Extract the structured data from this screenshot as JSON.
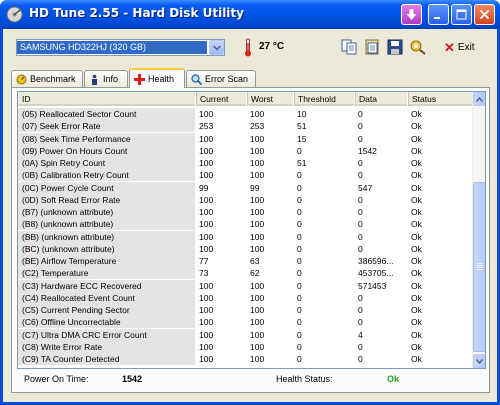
{
  "window": {
    "title": "HD Tune 2.55 - Hard Disk Utility"
  },
  "toolbar": {
    "drive": "SAMSUNG HD322HJ (320 GB)",
    "temperature": "27 °C",
    "exit_label": "Exit"
  },
  "tabs": [
    {
      "label": "Benchmark",
      "icon": "benchmark-icon"
    },
    {
      "label": "Info",
      "icon": "info-icon"
    },
    {
      "label": "Health",
      "icon": "health-cross-icon",
      "active": true
    },
    {
      "label": "Error Scan",
      "icon": "magnifier-icon"
    }
  ],
  "table": {
    "columns": [
      "ID",
      "Current",
      "Worst",
      "Threshold",
      "Data",
      "Status"
    ],
    "rows": [
      [
        "(05) Reallocated Sector Count",
        "100",
        "100",
        "10",
        "0",
        "Ok"
      ],
      [
        "(07) Seek Error Rate",
        "253",
        "253",
        "51",
        "0",
        "Ok"
      ],
      [
        "(08) Seek Time Performance",
        "100",
        "100",
        "15",
        "0",
        "Ok"
      ],
      [
        "(09) Power On Hours Count",
        "100",
        "100",
        "0",
        "1542",
        "Ok"
      ],
      [
        "(0A) Spin Retry Count",
        "100",
        "100",
        "51",
        "0",
        "Ok"
      ],
      [
        "(0B) Calibration Retry Count",
        "100",
        "100",
        "0",
        "0",
        "Ok"
      ],
      [
        "(0C) Power Cycle Count",
        "99",
        "99",
        "0",
        "547",
        "Ok"
      ],
      [
        "(0D) Soft Read Error Rate",
        "100",
        "100",
        "0",
        "0",
        "Ok"
      ],
      [
        "(B7) (unknown attribute)",
        "100",
        "100",
        "0",
        "0",
        "Ok"
      ],
      [
        "(B8) (unknown attribute)",
        "100",
        "100",
        "0",
        "0",
        "Ok"
      ],
      [
        "(BB) (unknown attribute)",
        "100",
        "100",
        "0",
        "0",
        "Ok"
      ],
      [
        "(BC) (unknown attribute)",
        "100",
        "100",
        "0",
        "0",
        "Ok"
      ],
      [
        "(BE) Airflow Temperature",
        "77",
        "63",
        "0",
        "386596...",
        "Ok"
      ],
      [
        "(C2) Temperature",
        "73",
        "62",
        "0",
        "453705...",
        "Ok"
      ],
      [
        "(C3) Hardware ECC Recovered",
        "100",
        "100",
        "0",
        "571453",
        "Ok"
      ],
      [
        "(C4) Reallocated Event Count",
        "100",
        "100",
        "0",
        "0",
        "Ok"
      ],
      [
        "(C5) Current Pending Sector",
        "100",
        "100",
        "0",
        "0",
        "Ok"
      ],
      [
        "(C6) Offline Uncorrectable",
        "100",
        "100",
        "0",
        "0",
        "Ok"
      ],
      [
        "(C7) Ultra DMA CRC Error Count",
        "100",
        "100",
        "0",
        "4",
        "Ok"
      ],
      [
        "(C8) Write Error Rate",
        "100",
        "100",
        "0",
        "0",
        "Ok"
      ],
      [
        "(C9) TA Counter Detected",
        "100",
        "100",
        "0",
        "0",
        "Ok"
      ]
    ]
  },
  "status": {
    "power_on_label": "Power On Time:",
    "power_on_value": "1542",
    "health_label": "Health Status:",
    "health_value": "Ok"
  },
  "colors": {
    "selection": "#316ac5",
    "ok_green": "#1fa31f",
    "titlebar": "#0054e3"
  }
}
